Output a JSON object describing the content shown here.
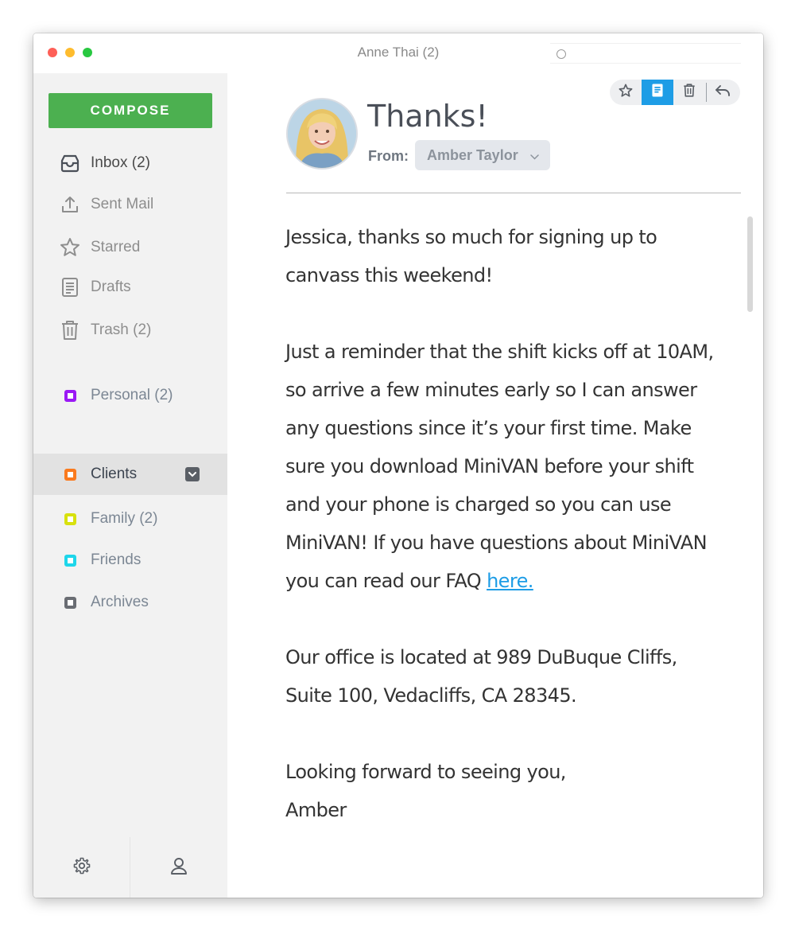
{
  "window": {
    "title": "Anne Thai (2)"
  },
  "sidebar": {
    "compose_label": "COMPOSE",
    "folders": [
      {
        "label": "Inbox (2)",
        "icon": "inbox-icon"
      },
      {
        "label": "Sent Mail",
        "icon": "upload-icon"
      },
      {
        "label": "Starred",
        "icon": "star-icon"
      },
      {
        "label": "Drafts",
        "icon": "document-icon"
      },
      {
        "label": "Trash (2)",
        "icon": "trash-icon"
      }
    ],
    "labels": [
      {
        "label": "Personal (2)",
        "color": "#9b19f5"
      },
      {
        "label": "Clients",
        "color": "#fa7a1e"
      },
      {
        "label": "Family (2)",
        "color": "#d8e10e"
      },
      {
        "label": "Friends",
        "color": "#1ed6ea"
      },
      {
        "label": "Archives",
        "color": "#6a6d73"
      }
    ],
    "footer": {
      "settings_icon": "gear-icon",
      "account_icon": "user-icon"
    }
  },
  "message": {
    "subject": "Thanks!",
    "from_label": "From:",
    "from_name": "Amber Taylor",
    "toolbar": [
      "star-icon",
      "document-icon",
      "trash-icon",
      "reply-icon"
    ],
    "paragraphs": {
      "p1": "Jessica, thanks so much for signing up to canvass this weekend!",
      "p2": "Just a reminder that the shift kicks off at 10AM, so arrive a few minutes early so I can answer any questions since it’s your first time. Make sure you download MiniVAN before your shift and your phone is charged so you can use MiniVAN! If you have questions about MiniVAN you can read our FAQ ",
      "p2_link": "here.",
      "p3": "Our office is located at 989 DuBuque Cliffs, Suite 100, Vedacliffs, CA 28345.",
      "p4_line1": "Looking forward to seeing you,",
      "p4_line2": "Amber"
    }
  },
  "colors": {
    "compose": "#4cb050",
    "accent": "#1e9de6"
  }
}
